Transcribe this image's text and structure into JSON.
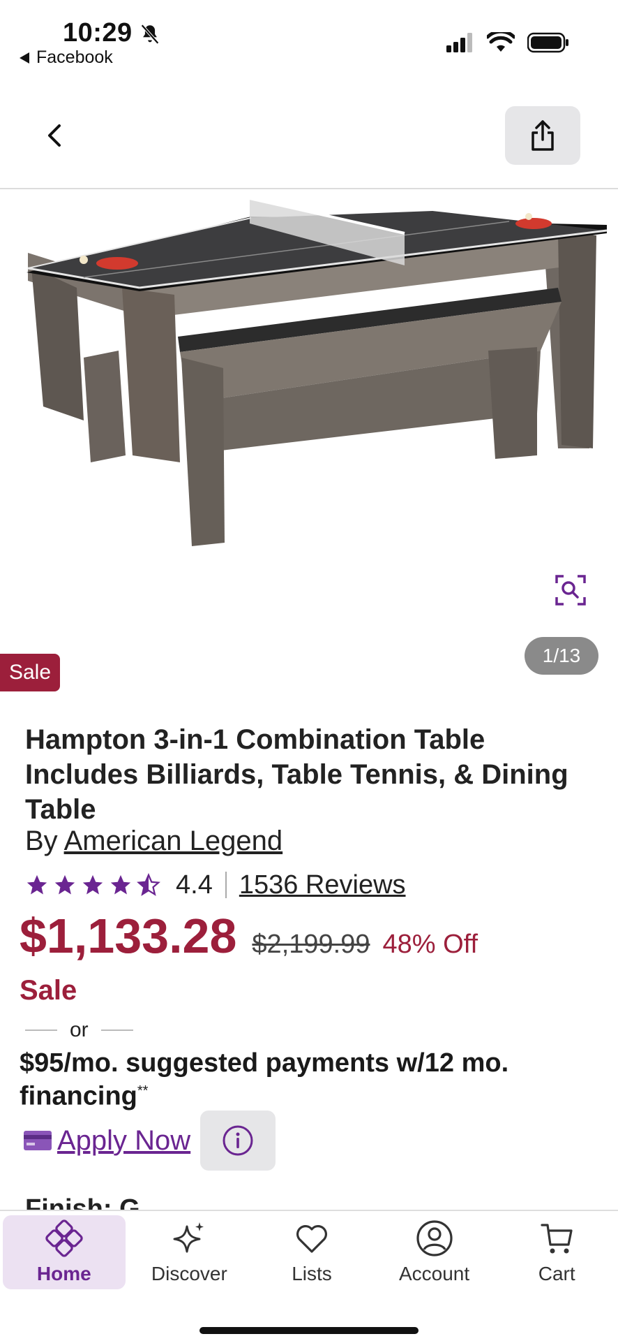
{
  "status": {
    "time": "10:29",
    "back_app": "Facebook"
  },
  "product": {
    "sale_badge": "Sale",
    "image_counter": "1/13",
    "title": "Hampton 3-in-1 Combination Table Includes Billiards, Table Tennis, & Dining Table",
    "by_prefix": "By",
    "brand": "American Legend",
    "rating": "4.4",
    "rating_value": 4.4,
    "reviews": "1536 Reviews",
    "price": "$1,133.28",
    "original_price": "$2,199.99",
    "discount": "48% Off",
    "sale_label": "Sale",
    "or_text": "or",
    "financing": "$95/mo. suggested payments w/12 mo. financing",
    "financing_mark": "**",
    "apply_now": "Apply Now",
    "cutoff_text": "Finish: G..."
  },
  "tabs": [
    {
      "label": "Home",
      "icon": "home-icon",
      "active": true
    },
    {
      "label": "Discover",
      "icon": "sparkle-icon",
      "active": false
    },
    {
      "label": "Lists",
      "icon": "heart-icon",
      "active": false
    },
    {
      "label": "Account",
      "icon": "account-icon",
      "active": false
    },
    {
      "label": "Cart",
      "icon": "cart-icon",
      "active": false
    }
  ],
  "colors": {
    "brand_purple": "#6a2591",
    "sale_red": "#9c1f3b"
  }
}
